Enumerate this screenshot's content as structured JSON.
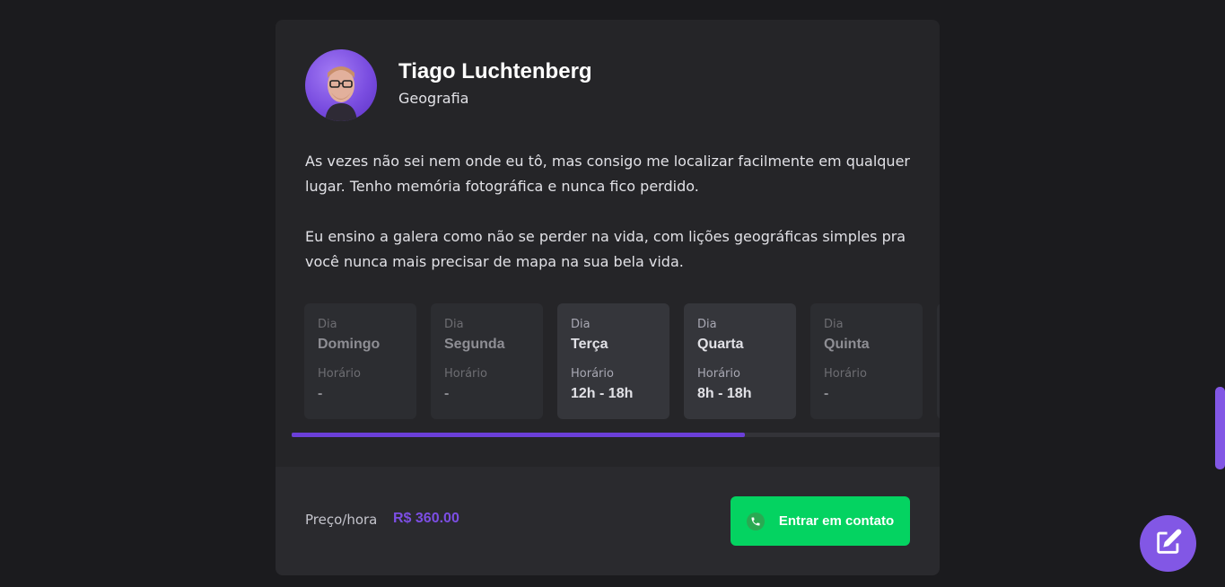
{
  "teacher": {
    "name": "Tiago Luchtenberg",
    "subject": "Geografia",
    "bio": [
      "As vezes não sei nem onde eu tô, mas consigo me localizar facilmente em qualquer lugar. Tenho memória fotográfica e nunca fico perdido.",
      "Eu ensino a galera como não se perder na vida, com lições geográficas simples pra você nunca mais precisar de mapa na sua bela vida."
    ]
  },
  "schedule": {
    "day_label": "Dia",
    "time_label": "Horário",
    "days": [
      {
        "day": "Domingo",
        "time": "-",
        "available": false
      },
      {
        "day": "Segunda",
        "time": "-",
        "available": false
      },
      {
        "day": "Terça",
        "time": "12h - 18h",
        "available": true
      },
      {
        "day": "Quarta",
        "time": "8h - 18h",
        "available": true
      },
      {
        "day": "Quinta",
        "time": "-",
        "available": false
      }
    ],
    "scroll_fraction": 0.7
  },
  "footer": {
    "price_label": "Preço/hora",
    "price_value": "R$ 360.00",
    "contact_label": "Entrar em contato"
  },
  "colors": {
    "accent": "#8257e5",
    "contact_green": "#04d361",
    "background": "#1b1b1e",
    "card": "#252528"
  },
  "icons": {
    "contact": "whatsapp-icon",
    "fab": "edit-icon"
  }
}
